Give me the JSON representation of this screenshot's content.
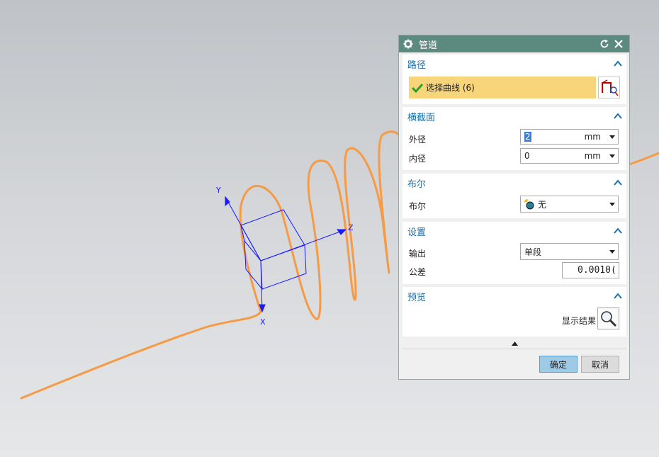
{
  "viewport": {
    "axes": {
      "x_label": "X",
      "y_label": "Y",
      "z_label": "Z"
    },
    "curve_color": "#f59a45",
    "triad_color": "#1a1aff"
  },
  "dialog": {
    "title": "管道",
    "icons": {
      "title_icon": "gear-icon",
      "reset": "reset-icon",
      "close": "close-icon"
    },
    "path": {
      "header": "路径",
      "select_curve_label": "选择曲线 (6)",
      "check_color": "#2aa02a"
    },
    "cross_section": {
      "header": "横截面",
      "outer_label": "外径",
      "outer_value": "2",
      "outer_unit": "mm",
      "inner_label": "内径",
      "inner_value": "0",
      "inner_unit": "mm"
    },
    "boolean": {
      "header": "布尔",
      "label": "布尔",
      "value": "无"
    },
    "settings": {
      "header": "设置",
      "output_label": "输出",
      "output_value": "单段",
      "tolerance_label": "公差",
      "tolerance_value": "0.0010("
    },
    "preview": {
      "header": "预览",
      "show_result_label": "显示结果"
    },
    "buttons": {
      "ok": "确定",
      "cancel": "取消"
    }
  }
}
